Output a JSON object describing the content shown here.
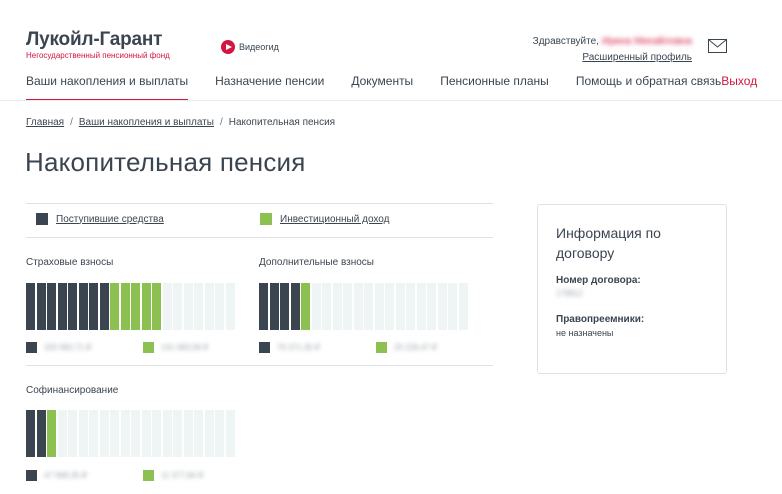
{
  "header": {
    "logo_title": "Лукойл-Гарант",
    "logo_subtitle": "Негосударственный пенсионный фонд",
    "video_label": "Видеогид",
    "greeting_prefix": "Здравствуйте,",
    "user_name": "Ирина Михайловна",
    "profile_link": "Расширенный профиль"
  },
  "nav": {
    "items": [
      "Ваши накопления и выплаты",
      "Назначение пенсии",
      "Документы",
      "Пенсионные планы",
      "Помощь и обратная связь"
    ],
    "logout": "Выход"
  },
  "breadcrumb": {
    "home": "Главная",
    "section": "Ваши накопления и выплаты",
    "current": "Накопительная пенсия",
    "separator": "/"
  },
  "page_title": "Накопительная пенсия",
  "legend": {
    "received": "Поступившие средства",
    "income": "Инвестиционный доход"
  },
  "colors": {
    "dark": "#3b4550",
    "green": "#8cc152",
    "accent": "#d3163f",
    "empty": "#eff4f4"
  },
  "charts": {
    "insurance": {
      "title": "Страховые взносы",
      "dark_bars": 8,
      "green_bars": 5,
      "total_bars": 20,
      "received": "320 982,71 ₽",
      "income": "141 083,08 ₽"
    },
    "additional": {
      "title": "Дополнительные взносы",
      "dark_bars": 4,
      "green_bars": 1,
      "total_bars": 20,
      "received": "76 371,35 ₽",
      "income": "20 226,47 ₽"
    },
    "cofinancing": {
      "title": "Софинансирование",
      "dark_bars": 2,
      "green_bars": 1,
      "total_bars": 20,
      "received": "47 968,35 ₽",
      "income": "11 377,84 ₽"
    }
  },
  "info": {
    "title": "Информация по договору",
    "contract_label": "Номер договора:",
    "contract_number": "179812",
    "successors_label": "Правопреемники:",
    "successors_value": "не назначены"
  }
}
